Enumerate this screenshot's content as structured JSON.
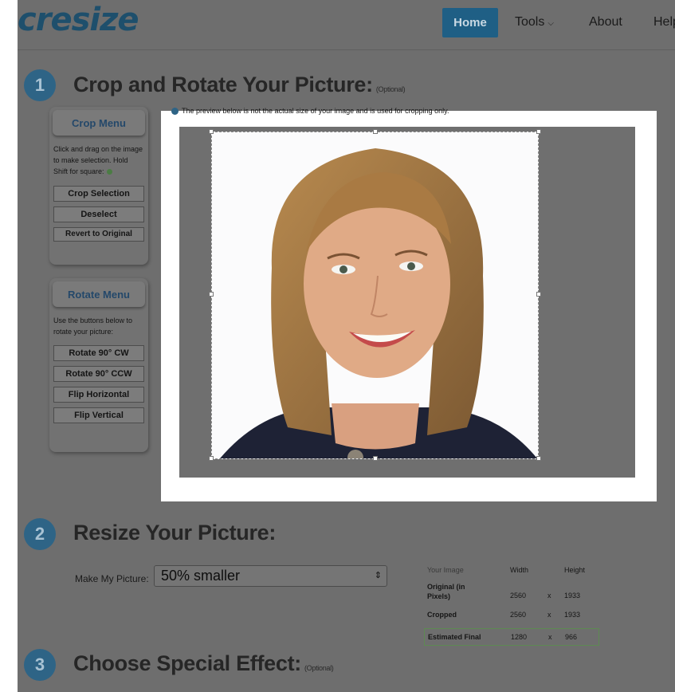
{
  "header": {
    "logo": "cresize",
    "nav": {
      "home": "Home",
      "tools": "Tools",
      "about": "About",
      "help": "Help"
    }
  },
  "step1": {
    "number": "1",
    "title": "Crop and Rotate Your Picture:",
    "optional": "(Optional)"
  },
  "crop_menu": {
    "title": "Crop Menu",
    "instructions": "Click and drag on the image to make selection. Hold Shift for square:",
    "buttons": [
      "Crop Selection",
      "Deselect",
      "Revert to Original"
    ]
  },
  "rotate_menu": {
    "title": "Rotate Menu",
    "instructions": "Use the buttons below to rotate your picture:",
    "buttons": [
      "Rotate 90° CW",
      "Rotate 90° CCW",
      "Flip Horizontal",
      "Flip Vertical"
    ]
  },
  "preview": {
    "note": "The preview below is not the actual size of your image and is used for cropping only."
  },
  "step2": {
    "number": "2",
    "title": "Resize Your Picture:",
    "make_label": "Make My Picture:",
    "selected_option": "50% smaller",
    "table": {
      "header": {
        "label": "Your Image",
        "width": "Width",
        "height": "Height"
      },
      "rows": [
        {
          "label": "Original (in Pixels)",
          "width": "2560",
          "x": "x",
          "height": "1933"
        },
        {
          "label": "Cropped",
          "width": "2560",
          "x": "x",
          "height": "1933"
        },
        {
          "label": "Estimated Final",
          "width": "1280",
          "x": "x",
          "height": "966"
        }
      ]
    }
  },
  "step3": {
    "number": "3",
    "title": "Choose Special Effect:",
    "optional": "(Optional)"
  },
  "colors": {
    "accent": "#1f5f85",
    "step_circle": "#2e6486",
    "estimate_border": "#5d8a52"
  }
}
